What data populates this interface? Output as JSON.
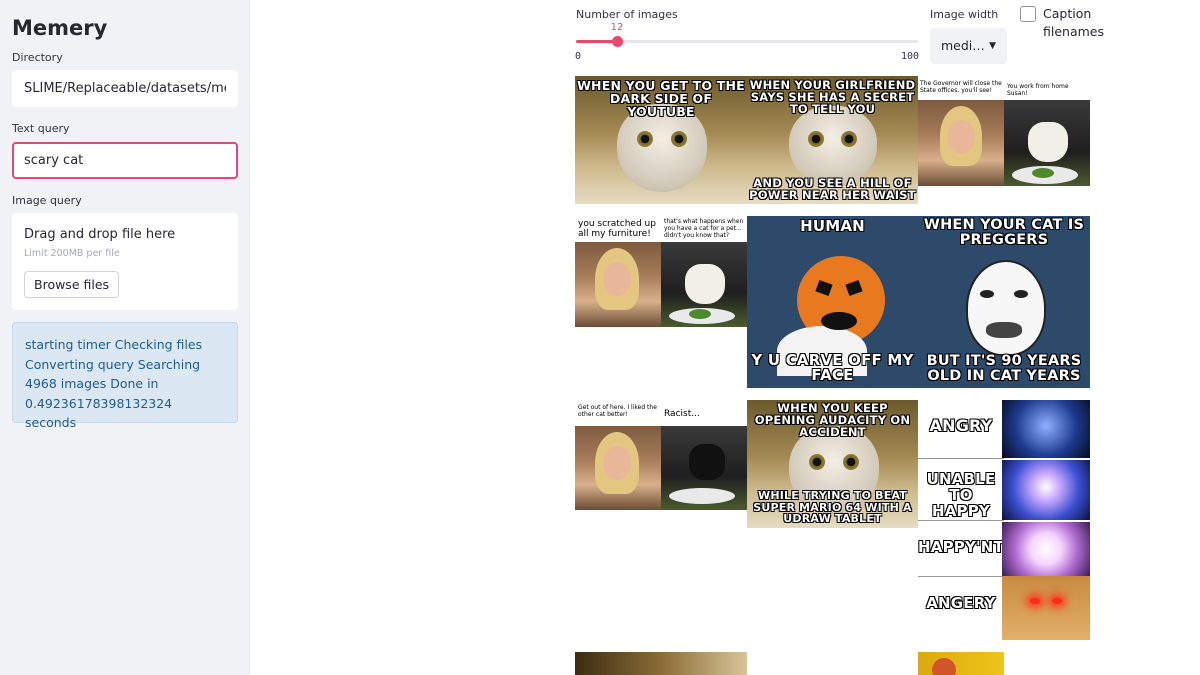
{
  "sidebar": {
    "title": "Memery",
    "directory_label": "Directory",
    "directory_value": "SLIME/Replaceable/datasets/memes/",
    "text_query_label": "Text query",
    "text_query_value": "scary cat",
    "image_query_label": "Image query",
    "uploader": {
      "title": "Drag and drop file here",
      "limit": "Limit 200MB per file",
      "button": "Browse files"
    },
    "status": "starting timer Checking files Converting query Searching 4968 images Done in 0.49236178398132324 seconds"
  },
  "controls": {
    "num_images": {
      "label": "Number of images",
      "value": "12",
      "min": "0",
      "max": "100",
      "fraction": 0.12
    },
    "image_width": {
      "label": "Image width",
      "value": "medi…",
      "arrow": "chevron-down-icon"
    },
    "caption": {
      "label": "Caption filenames",
      "checked": false
    }
  },
  "memes": {
    "m1": {
      "top": "WHEN YOU GET TO THE DARK SIDE OF YOUTUBE"
    },
    "m2": {
      "top": "WHEN YOUR GIRLFRIEND SAYS SHE HAS A SECRET TO TELL YOU",
      "bottom": "AND YOU SEE A HILL OF POWER NEAR HER WAIST"
    },
    "m3": {
      "left": "The Governor will close the State offices, you'll see!",
      "right": "You work from home Susan!"
    },
    "m4": {
      "left": "you scratched up all my furniture!",
      "right": "that's what happens when you have a cat for a pet... didn't you know that?"
    },
    "m5": {
      "top": "HUMAN",
      "bottom": "Y U CARVE OFF MY FACE"
    },
    "m6": {
      "top": "WHEN YOUR CAT IS PREGGERS",
      "bottom": "BUT IT'S 90 YEARS OLD IN CAT YEARS"
    },
    "m7": {
      "left": "Get out of here. I liked the other cat better!",
      "right": "Racist..."
    },
    "m8": {
      "top": "WHEN YOU KEEP OPENING AUDACITY ON ACCIDENT",
      "bottom": "WHILE TRYING TO BEAT SUPER MARIO 64 WITH A UDRAW TABLET"
    },
    "m9": {
      "r1": "ANGRY",
      "r2": "UNABLE TO HAPPY",
      "r3": "HAPPY'NT",
      "r4": "ANGERY"
    }
  },
  "colors": {
    "accent": "#f0456d",
    "focus_border": "#e64775",
    "sidebar_bg": "#f0f2f6",
    "info_bg": "#dbe8f3",
    "info_text": "#1f5b8c",
    "meme_navy": "#2e4a6b"
  }
}
